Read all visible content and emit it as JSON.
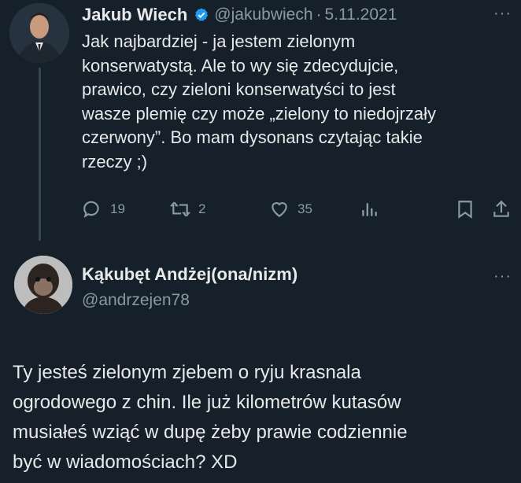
{
  "tweet": {
    "author_name": "Jakub Wiech",
    "handle": "@jakubwiech",
    "separator": "·",
    "date": "5.11.2021",
    "more": "···",
    "text": "Jak najbardziej - ja jestem zielonym\nkonserwatystą. Ale to wy się zdecydujcie,\nprawico, czy zieloni konserwatyści to jest\nwasze plemię czy może „zielony to niedojrzały\nczerwony”. Bo mam dysonans czytając takie\nrzeczy ;)",
    "replies": "19",
    "retweets": "2",
    "likes": "35"
  },
  "reply": {
    "author_name": "Kąkubęt Andżej(ona/nizm)",
    "handle": "@andrzejen78",
    "more": "···",
    "text": "Ty jesteś zielonym zjebem o ryju krasnala\nogrodowego z chin. Ile już kilometrów kutasów\nmusiałeś wziąć w dupę żeby prawie codziennie\nbyć w wiadomościach? XD"
  },
  "colors": {
    "background": "#15202b",
    "text": "#e7e9ea",
    "muted": "#8b98a5",
    "verified": "#1d9bf0"
  },
  "icons": [
    "verified-badge-icon",
    "reply-icon",
    "retweet-icon",
    "like-icon",
    "views-icon",
    "bookmark-icon",
    "share-icon",
    "more-icon"
  ]
}
